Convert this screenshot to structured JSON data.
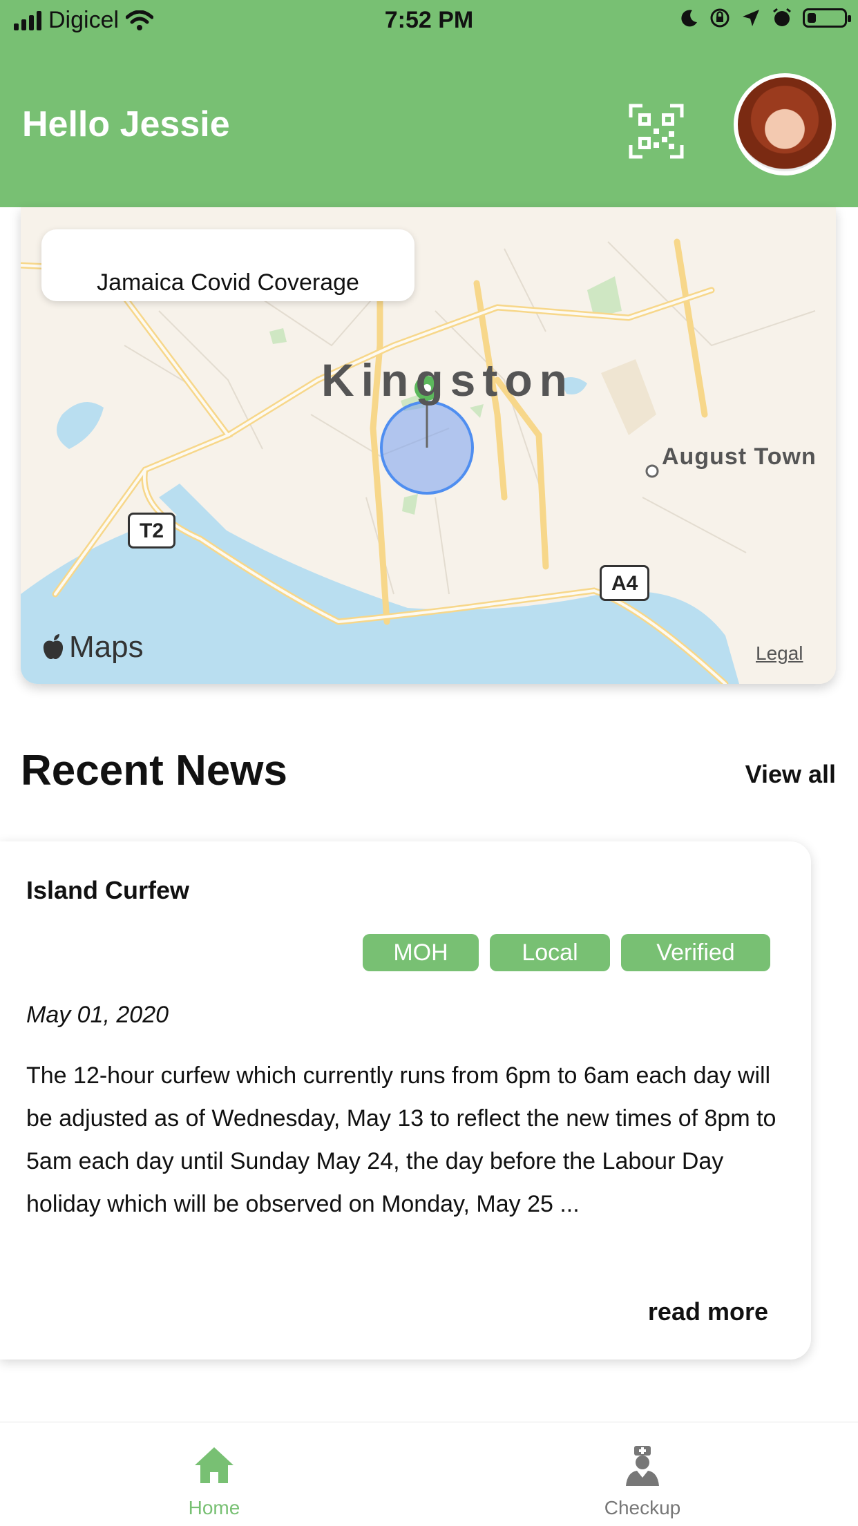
{
  "status_bar": {
    "carrier": "Digicel",
    "time": "7:52 PM"
  },
  "header": {
    "greeting": "Hello Jessie",
    "qr_icon": "qr-code-icon",
    "avatar": "profile-avatar"
  },
  "map": {
    "title": "Jamaica Covid Coverage",
    "city_label": "Kingston",
    "town_label": "August Town",
    "road_shields": [
      "T2",
      "A4"
    ],
    "brand": "Maps",
    "legal": "Legal"
  },
  "news_section": {
    "title": "Recent News",
    "view_all": "View all",
    "card": {
      "title": "Island Curfew",
      "tags": [
        "MOH",
        "Local",
        "Verified"
      ],
      "date": "May 01, 2020",
      "body": "The 12-hour curfew which currently runs from 6pm to 6am each day will be adjusted as of Wednesday, May 13 to reflect the new times of 8pm to 5am each day until Sunday May 24, the day before the Labour Day holiday which will be observed on Monday, May 25 ...",
      "read_more": "read more"
    }
  },
  "tabbar": {
    "items": [
      {
        "label": "Home",
        "icon": "home-icon",
        "active": true
      },
      {
        "label": "Checkup",
        "icon": "doctor-icon",
        "active": false
      }
    ]
  },
  "colors": {
    "brand_green": "#78c073",
    "inactive_gray": "#777777",
    "water_blue": "#b9def0"
  }
}
